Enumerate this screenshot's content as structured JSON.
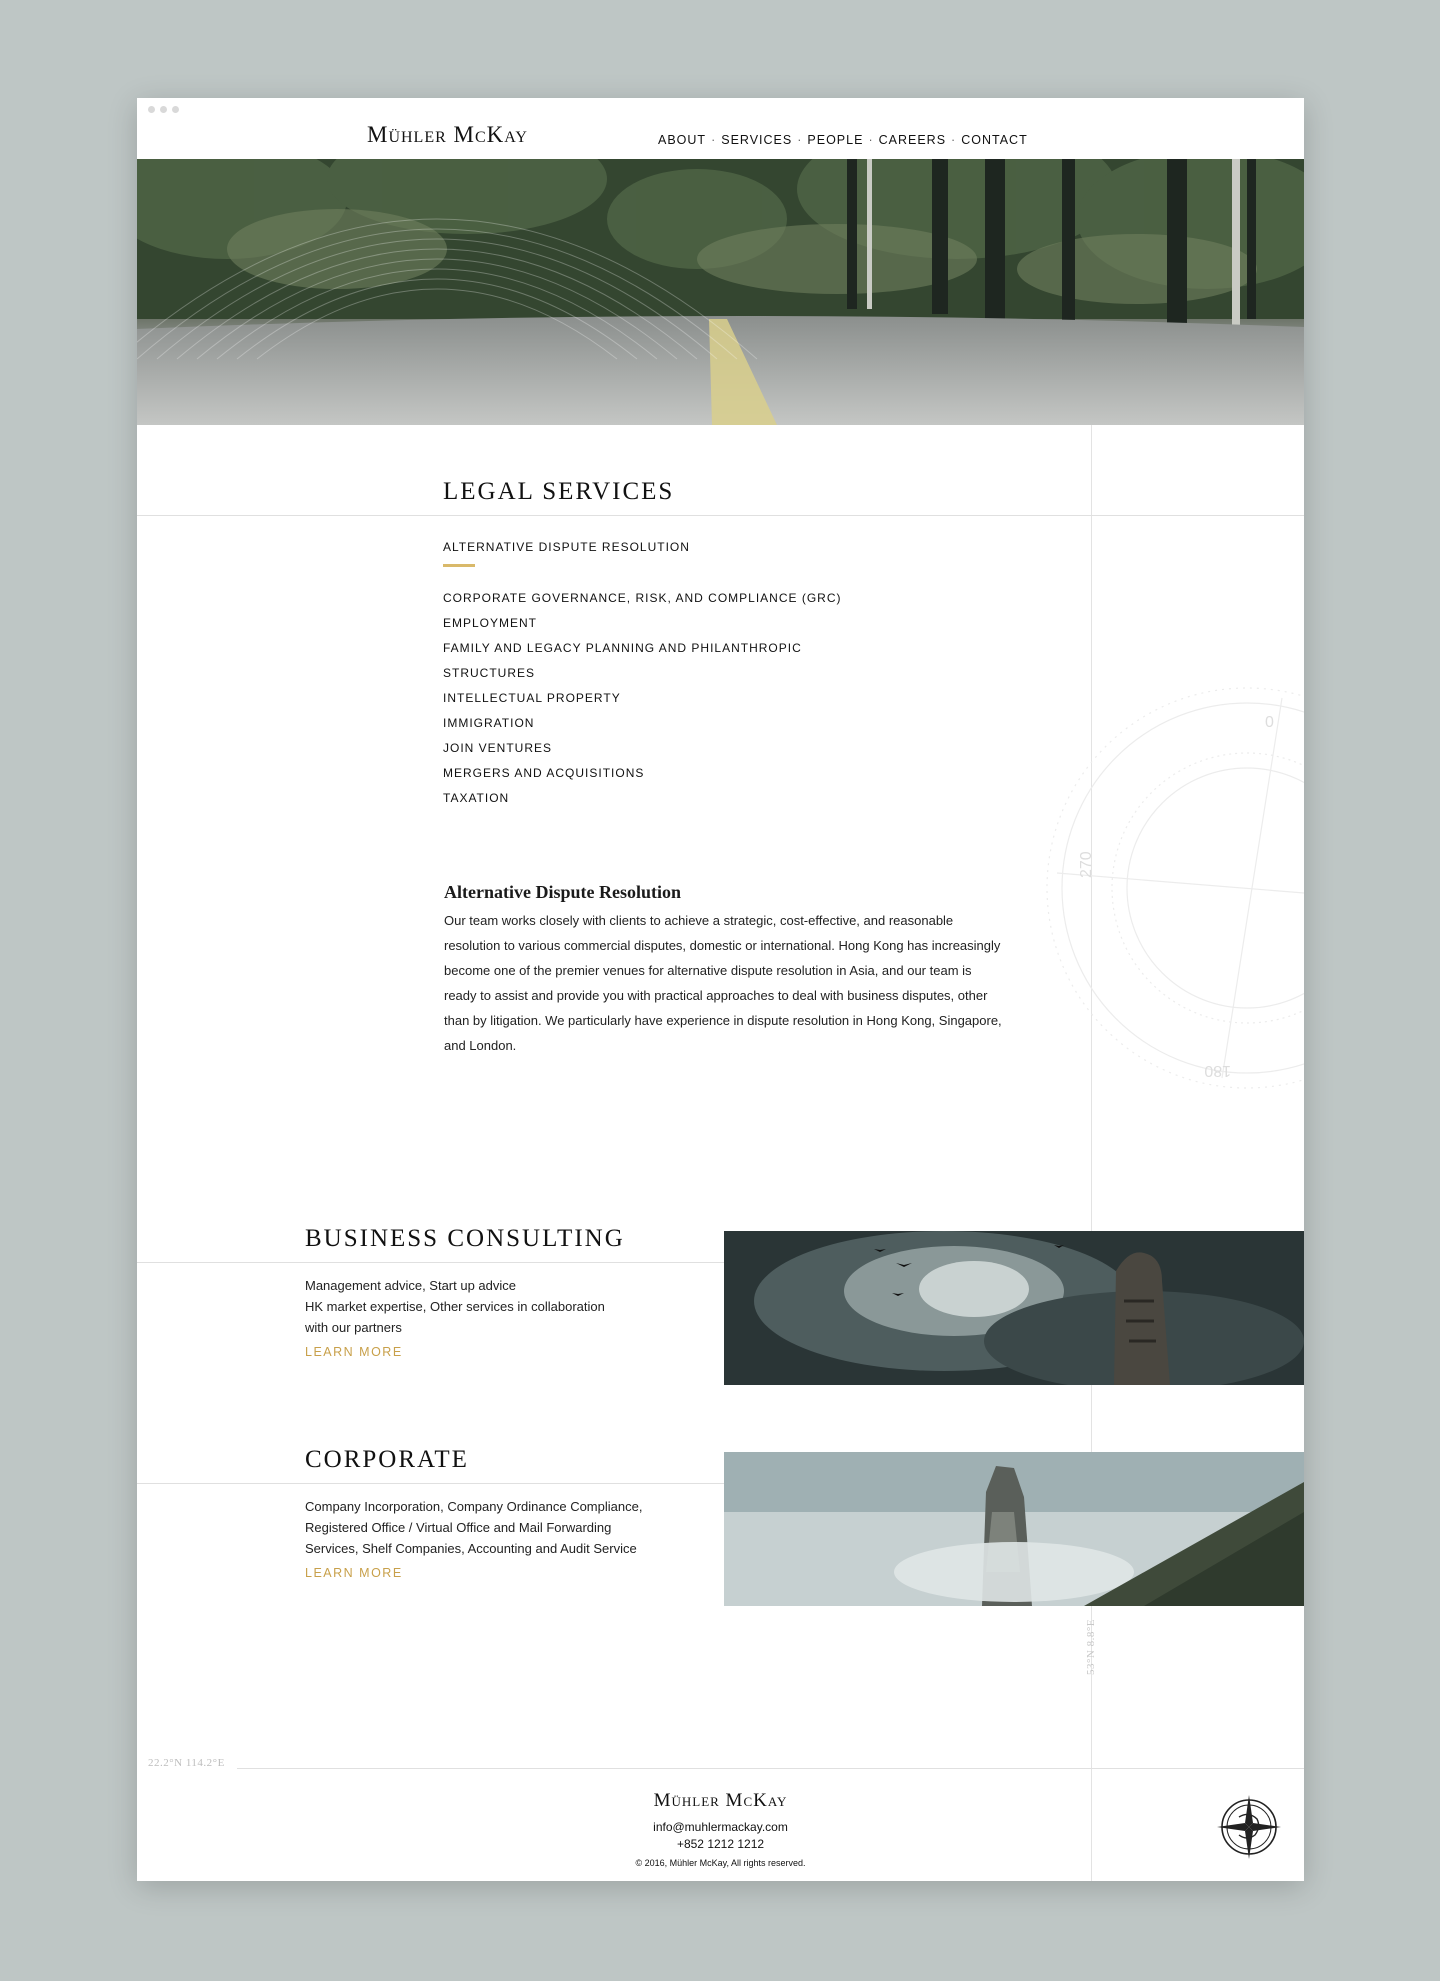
{
  "brand": {
    "name": "Mühler McKay"
  },
  "nav": {
    "items": [
      "ABOUT",
      "SERVICES",
      "PEOPLE",
      "CAREERS",
      "CONTACT"
    ],
    "separator": "·",
    "active": "SERVICES"
  },
  "legal": {
    "title": "LEGAL SERVICES",
    "active_item": "ALTERNATIVE DISPUTE RESOLUTION",
    "items": [
      "CORPORATE GOVERNANCE, RISK, AND COMPLIANCE (GRC)",
      "EMPLOYMENT",
      "FAMILY AND LEGACY PLANNING AND PHILANTHROPIC",
      "STRUCTURES",
      "INTELLECTUAL PROPERTY",
      "IMMIGRATION",
      "JOIN VENTURES",
      "MERGERS AND ACQUISITIONS",
      "TAXATION"
    ],
    "detail_title": "Alternative Dispute Resolution",
    "detail_body": "Our team works closely with clients to achieve a strategic, cost-effective, and reasonable resolution to various commercial disputes, domestic or international. Hong Kong has increasingly become one of the premier venues for alternative dispute resolution in Asia, and our team is ready to assist and provide you with practical approaches to deal with business disputes, other than by litigation. We particularly have experience in dispute resolution in Hong Kong, Singapore, and London."
  },
  "business": {
    "title": "BUSINESS CONSULTING",
    "lines": [
      "Management advice, Start up advice",
      "HK market expertise, Other services in collaboration",
      "with our partners"
    ],
    "link": "LEARN MORE"
  },
  "corporate": {
    "title": "CORPORATE",
    "lines": [
      "Company Incorporation, Company Ordinance Compliance,",
      "Registered Office / Virtual Office and Mail Forwarding",
      "Services, Shelf Companies, Accounting and Audit Service"
    ],
    "link": "LEARN MORE"
  },
  "compass_marks": {
    "n": "0",
    "w": "270",
    "s": "180"
  },
  "coordinates": {
    "left": "22.2°N 114.2°E",
    "vertical": "53°N 8.8°E"
  },
  "footer": {
    "logo": "Mühler McKay",
    "email": "info@muhlermackay.com",
    "phone": "+852 1212 1212",
    "copyright": "© 2016, Mühler McKay, All rights reserved."
  },
  "colors": {
    "accent": "#d9b96a",
    "link": "#c8a04a",
    "background": "#bec6c5"
  },
  "icons": [
    "compass-logo-icon"
  ]
}
